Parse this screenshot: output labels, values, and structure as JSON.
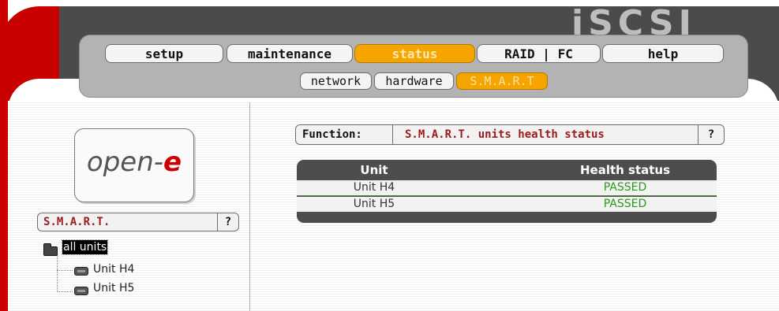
{
  "brand": {
    "logo_text": "iSCSI",
    "company_prefix": "open-",
    "company_suffix": "e"
  },
  "nav": {
    "tabs": [
      {
        "label": "setup",
        "active": false
      },
      {
        "label": "maintenance",
        "active": false
      },
      {
        "label": "status",
        "active": true
      },
      {
        "label": "RAID | FC",
        "active": false
      },
      {
        "label": "help",
        "active": false
      }
    ],
    "subtabs": [
      {
        "label": "network",
        "active": false
      },
      {
        "label": "hardware",
        "active": false
      },
      {
        "label": "S.M.A.R.T",
        "active": true
      }
    ]
  },
  "sidebar": {
    "section_title": "S.M.A.R.T.",
    "help_label": "?",
    "tree": {
      "root_label": "all units",
      "items": [
        {
          "label": "Unit H4"
        },
        {
          "label": "Unit H5"
        }
      ]
    }
  },
  "main": {
    "function_label": "Function:",
    "function_value": "S.M.A.R.T. units health status",
    "help_label": "?",
    "table": {
      "columns": [
        "Unit",
        "Health status"
      ],
      "rows": [
        {
          "unit": "Unit H4",
          "health": "PASSED"
        },
        {
          "unit": "Unit H5",
          "health": "PASSED"
        }
      ]
    }
  },
  "colors": {
    "accent": "#f6a500",
    "brand_red": "#cc0000",
    "ok_green": "#2a9a1a",
    "header_dark": "#4b4b4b"
  }
}
